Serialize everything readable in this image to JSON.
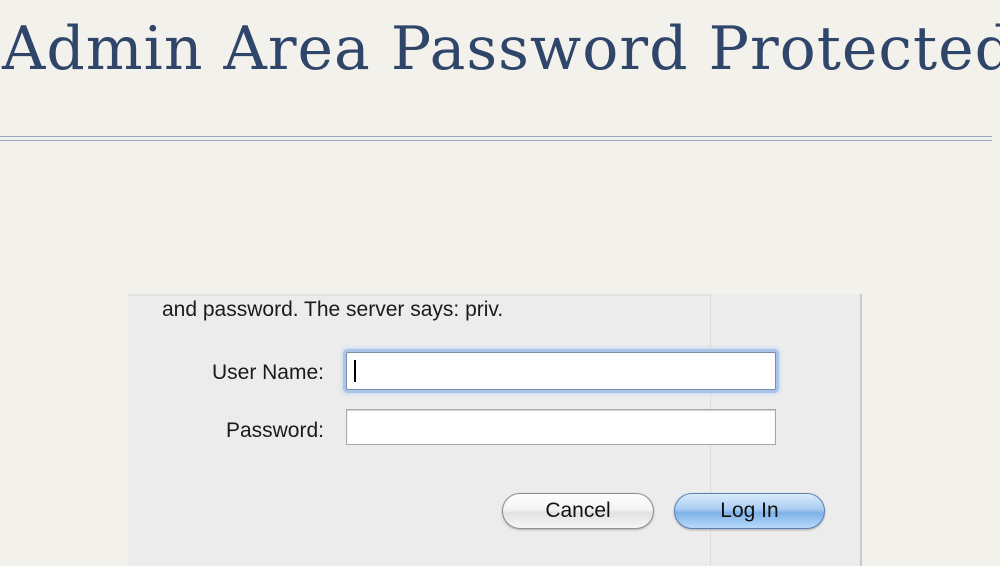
{
  "slide": {
    "title": "Admin Area Password Protected"
  },
  "dialog": {
    "message": "and password. The server says: priv.",
    "username_label": "User Name:",
    "username_value": "",
    "password_label": "Password:",
    "password_value": "",
    "cancel_label": "Cancel",
    "login_label": "Log In"
  },
  "colors": {
    "background": "#f3f1ec",
    "title": "#2f4569",
    "rule": "#9aa8bf",
    "dialog": "#ececec",
    "focus_ring": "#a9c4e6",
    "default_button": "#7fb2e8"
  }
}
